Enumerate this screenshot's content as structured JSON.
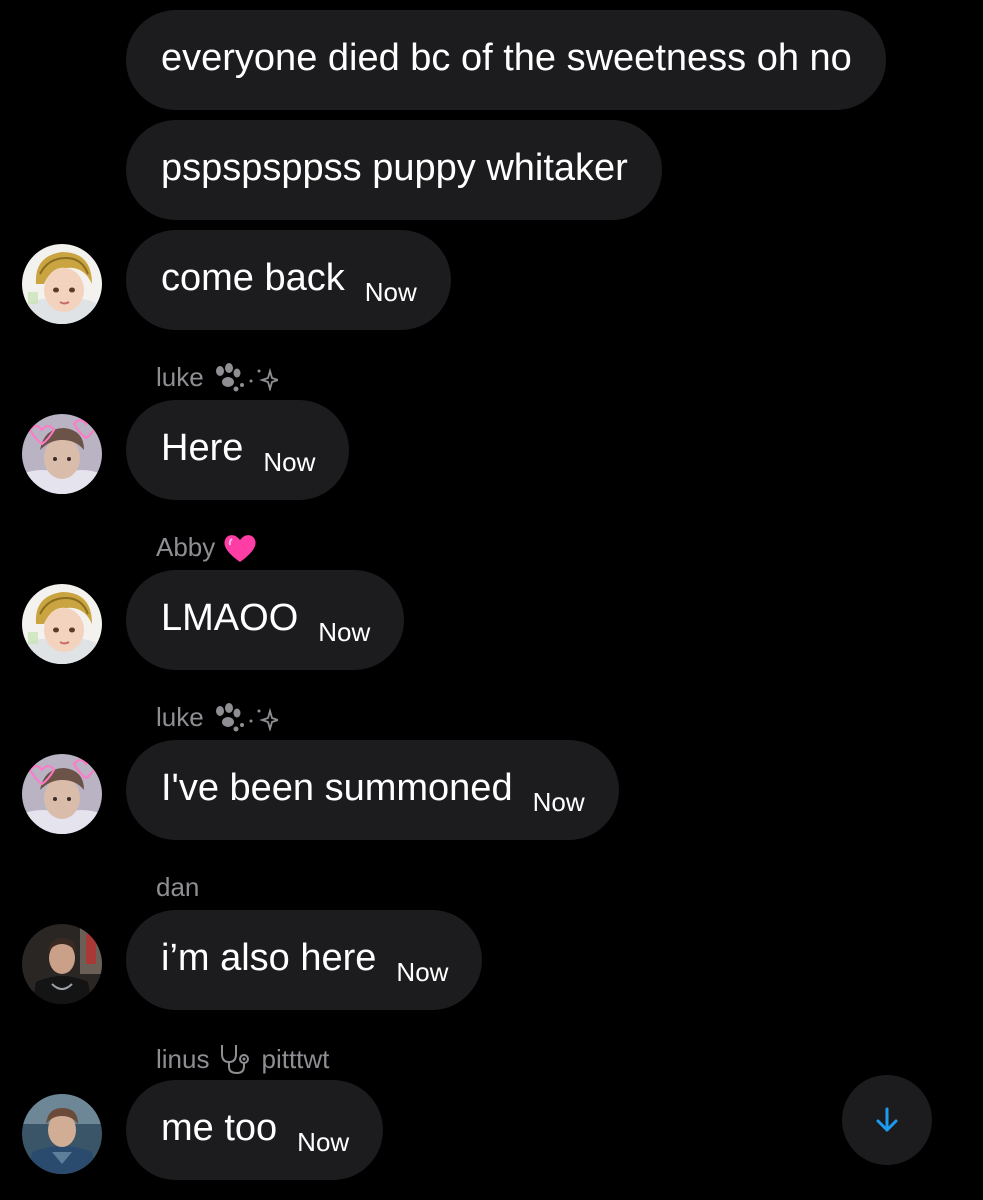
{
  "theme": {
    "background": "#000000",
    "bubble": "#1c1c1e",
    "sender_name": "#8e8e93",
    "scroll_arrow": "#1d9bf0"
  },
  "messages": [
    {
      "text": "everyone died bc of the sweetness oh no",
      "time": ""
    },
    {
      "text": "pspspsppss puppy whitaker",
      "time": ""
    },
    {
      "text": "come back",
      "time": "Now",
      "avatar": "blond-anime-avatar"
    },
    {
      "sender": "luke",
      "sender_icons": [
        "paw-print-icon",
        "sparkle-icon"
      ],
      "text": "Here",
      "time": "Now",
      "avatar": "pink-hearts-avatar"
    },
    {
      "sender": "Abby",
      "sender_icons": [
        "pink-heart-icon"
      ],
      "text": "LMAOO",
      "time": "Now",
      "avatar": "blond-anime-avatar"
    },
    {
      "sender": "luke",
      "sender_icons": [
        "paw-print-icon",
        "sparkle-icon"
      ],
      "text": "I've been summoned",
      "time": "Now",
      "avatar": "pink-hearts-avatar"
    },
    {
      "sender": "dan",
      "text": "i’m also here",
      "time": "Now",
      "avatar": "dark-photo-avatar"
    },
    {
      "sender": "linus",
      "sender_icons": [
        "stethoscope-icon"
      ],
      "sender_suffix": "pitttwt",
      "text": "me too",
      "time": "Now",
      "avatar": "blue-photo-avatar"
    }
  ],
  "scroll_button": {
    "icon": "arrow-down-icon"
  }
}
